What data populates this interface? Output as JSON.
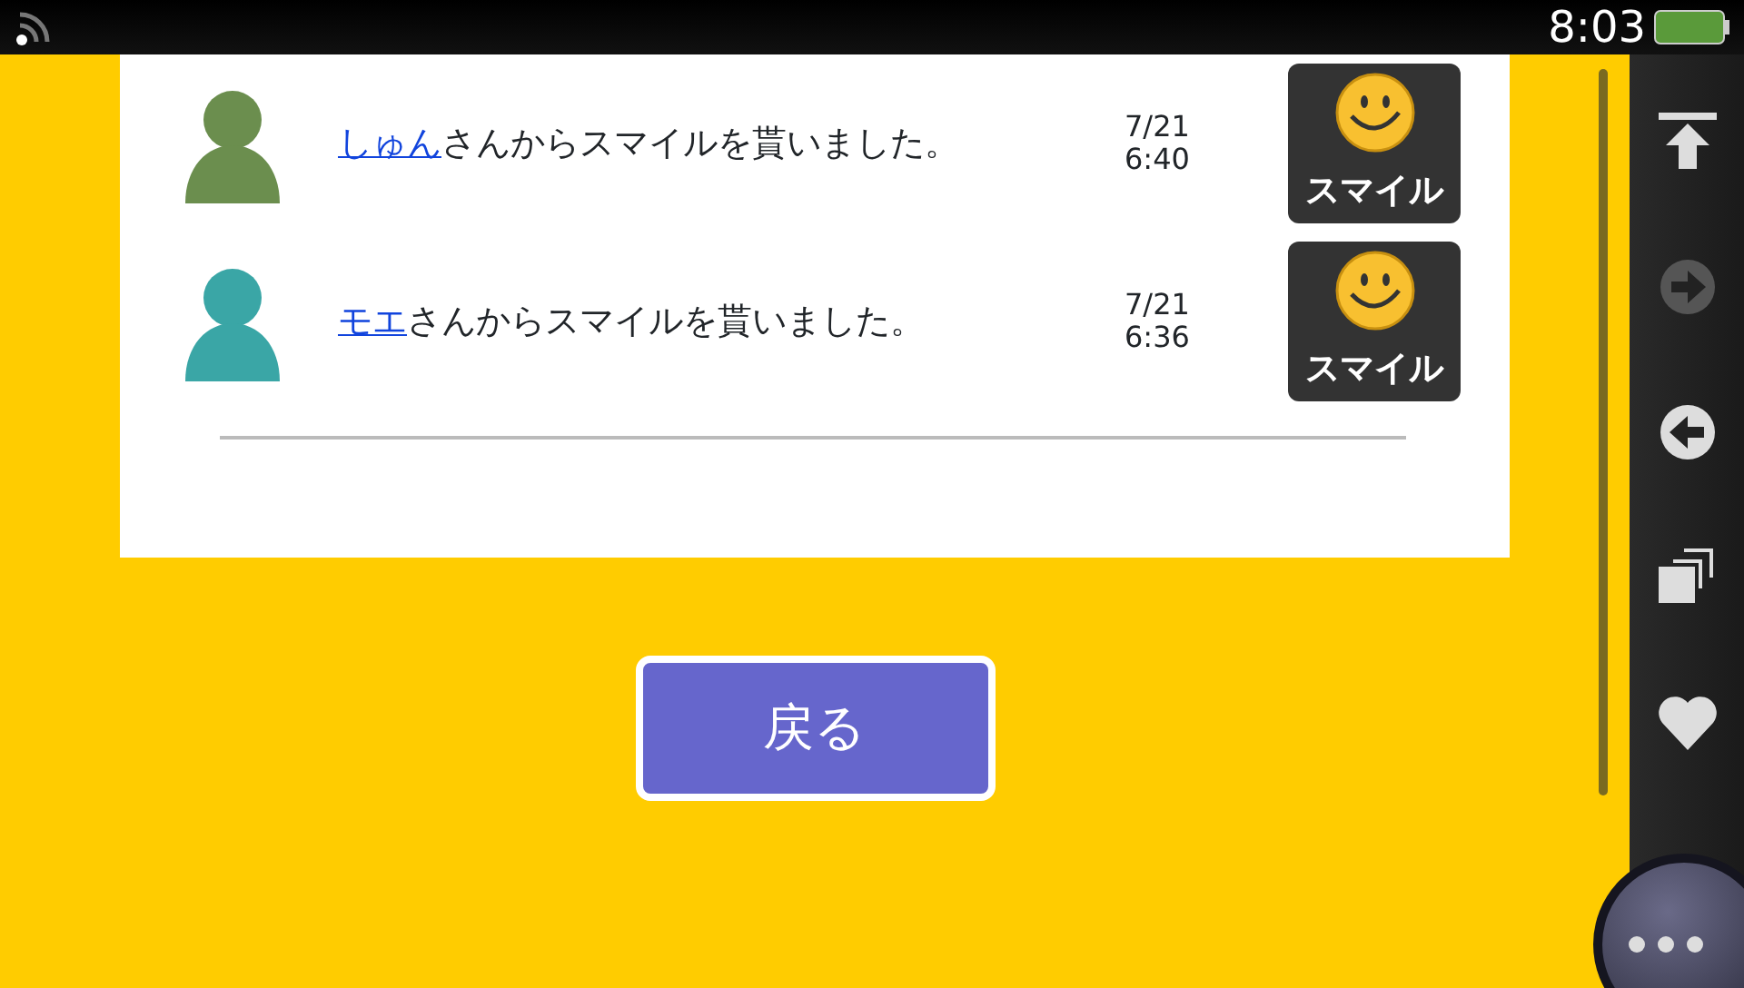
{
  "status_bar": {
    "time": "8:03"
  },
  "notifications": [
    {
      "name": "しゅん",
      "message": "さんからスマイルを貰いました。",
      "date": "7/21",
      "time": "6:40",
      "badge": "スマイル"
    },
    {
      "name": "モエ",
      "message": "さんからスマイルを貰いました。",
      "date": "7/21",
      "time": "6:36",
      "badge": "スマイル"
    }
  ],
  "back_button": "戻る",
  "side_buttons": [
    {
      "kind": "top",
      "disabled": false
    },
    {
      "kind": "forward",
      "disabled": true
    },
    {
      "kind": "back",
      "disabled": false
    },
    {
      "kind": "windows",
      "disabled": false
    },
    {
      "kind": "favorite",
      "disabled": false
    }
  ]
}
